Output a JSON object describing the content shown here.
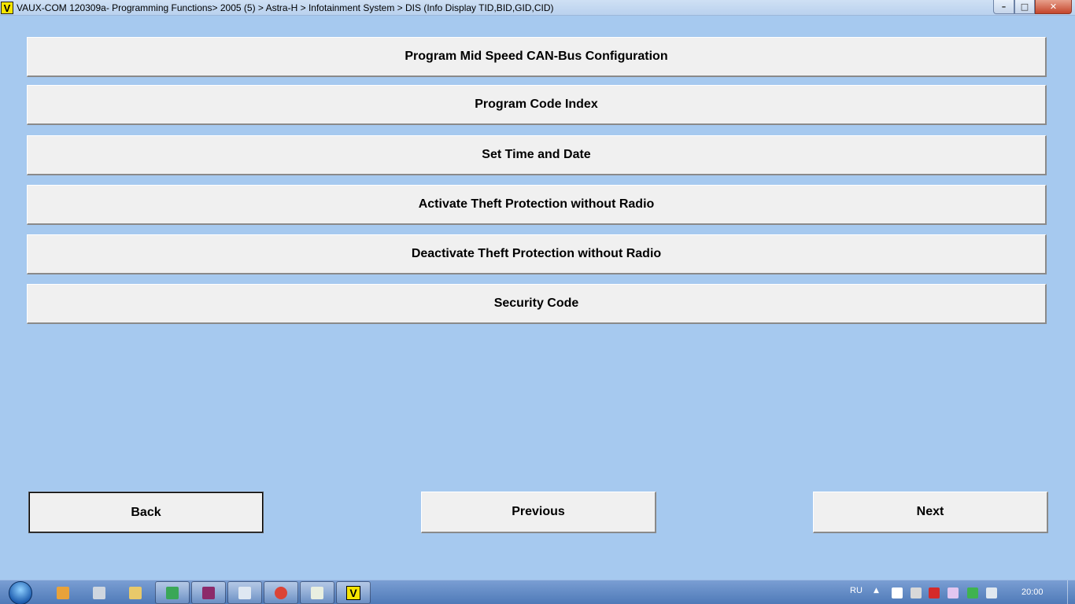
{
  "window": {
    "app_icon_letter": "V",
    "title": "VAUX-COM 120309a- Programming Functions> 2005 (5) > Astra-H > Infotainment System > DIS (Info Display TID,BID,GID,CID)",
    "minimize_glyph": "–",
    "maximize_glyph": "□",
    "close_glyph": "✕"
  },
  "menu": {
    "items": [
      {
        "label": "Program Mid Speed CAN-Bus Configuration"
      },
      {
        "label": "Program Code Index"
      },
      {
        "label": "Set Time and Date"
      },
      {
        "label": "Activate Theft Protection without Radio"
      },
      {
        "label": "Deactivate Theft Protection without Radio"
      },
      {
        "label": "Security Code"
      }
    ]
  },
  "navigation": {
    "back_label": "Back",
    "previous_label": "Previous",
    "next_label": "Next"
  },
  "taskbar": {
    "items": [
      {
        "icon": "media-player-icon",
        "color": "#e8a23a"
      },
      {
        "icon": "video-editor-icon",
        "color": "#cfd6df"
      },
      {
        "icon": "file-explorer-icon",
        "color": "#e8c96a"
      },
      {
        "icon": "drive-icon",
        "color": "#3aa757"
      },
      {
        "icon": "winrar-icon",
        "color": "#8c2a6a"
      },
      {
        "icon": "notepad-icon",
        "color": "#dfe8f2"
      },
      {
        "icon": "chrome-icon",
        "color": "#db4437"
      },
      {
        "icon": "window-app-icon",
        "color": "#e9efe0"
      },
      {
        "icon": "vauxcom-icon",
        "color": "#f6e400",
        "letter": "V"
      }
    ],
    "tray": {
      "language": "RU",
      "overflow_glyph": "▲",
      "icons": [
        {
          "icon": "windows-flag-icon",
          "color": "#ffffff"
        },
        {
          "icon": "usb-device-icon",
          "color": "#d8d8d8"
        },
        {
          "icon": "antivirus-icon",
          "color": "#d42a2a"
        },
        {
          "icon": "display-icon",
          "color": "#e2c6f0"
        },
        {
          "icon": "security-shield-icon",
          "color": "#3fb34f"
        },
        {
          "icon": "network-signal-icon",
          "color": "#e0e8f0"
        }
      ],
      "clock": "20:00"
    }
  }
}
